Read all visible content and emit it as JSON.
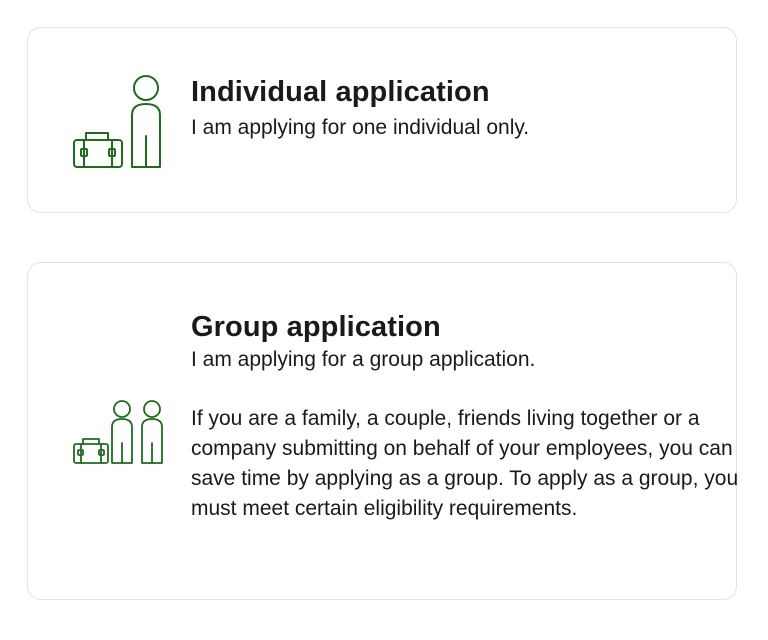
{
  "options": {
    "individual": {
      "title": "Individual application",
      "subtitle": "I am applying for one individual only.",
      "icon": "person-with-suitcase-icon"
    },
    "group": {
      "title": "Group application",
      "subtitle": "I am applying for a group application.",
      "description": "If you are a family, a couple, friends living together or a company submitting on behalf of your employees, you can save time by applying as a group. To apply as a group, you must meet certain eligibility requirements.",
      "icon": "group-with-suitcase-icon"
    }
  },
  "colors": {
    "icon_green": "#1f6b1f",
    "card_border": "#e2e2e2",
    "text": "#1a1a1a"
  }
}
